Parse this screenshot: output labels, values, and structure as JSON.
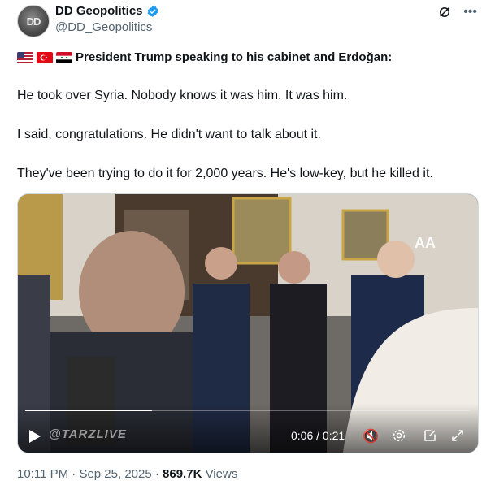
{
  "account": {
    "name": "DD Geopolitics",
    "handle": "@DD_Geopolitics",
    "avatar_text": "DD"
  },
  "post": {
    "flags": [
      "us-flag",
      "turkey-flag",
      "syria-flag"
    ],
    "headline": "President Trump speaking to his cabinet and Erdoğan:",
    "paragraphs": [
      "He took over Syria. Nobody knows it was him. It was him.",
      "I said, congratulations. He didn't want to talk about it.",
      "They've been trying to do it for 2,000 years. He's low-key, but he killed it."
    ]
  },
  "video": {
    "current_time": "0:06",
    "separator": " / ",
    "duration": "0:21",
    "progress_fraction": 0.285,
    "watermark": "@TARZLIVE",
    "source_logo": "AA"
  },
  "footer": {
    "time": "10:11 PM",
    "dot": " · ",
    "date": "Sep 25, 2025",
    "views_count": "869.7K",
    "views_label": " Views"
  },
  "colors": {
    "verified": "#1d9bf0",
    "muted": "#536471"
  }
}
